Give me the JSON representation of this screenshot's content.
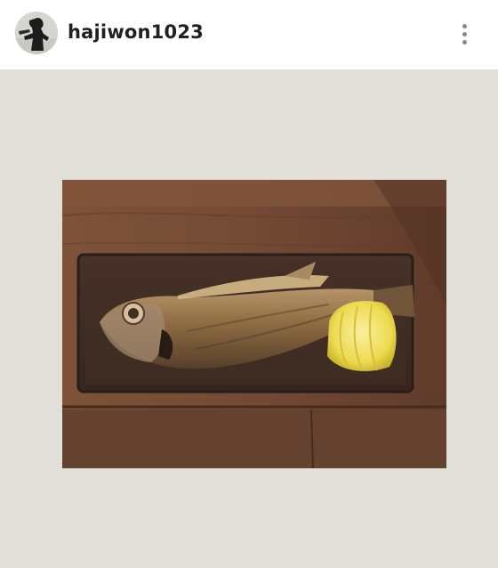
{
  "post": {
    "username": "hajiwon1023",
    "avatar_icon": "profile-avatar",
    "more_icon": "more-vertical-icon"
  },
  "colors": {
    "header_bg": "#ffffff",
    "media_bg": "#e0dfd8",
    "username": "#202020",
    "more_dots": "#8a8a8a"
  }
}
